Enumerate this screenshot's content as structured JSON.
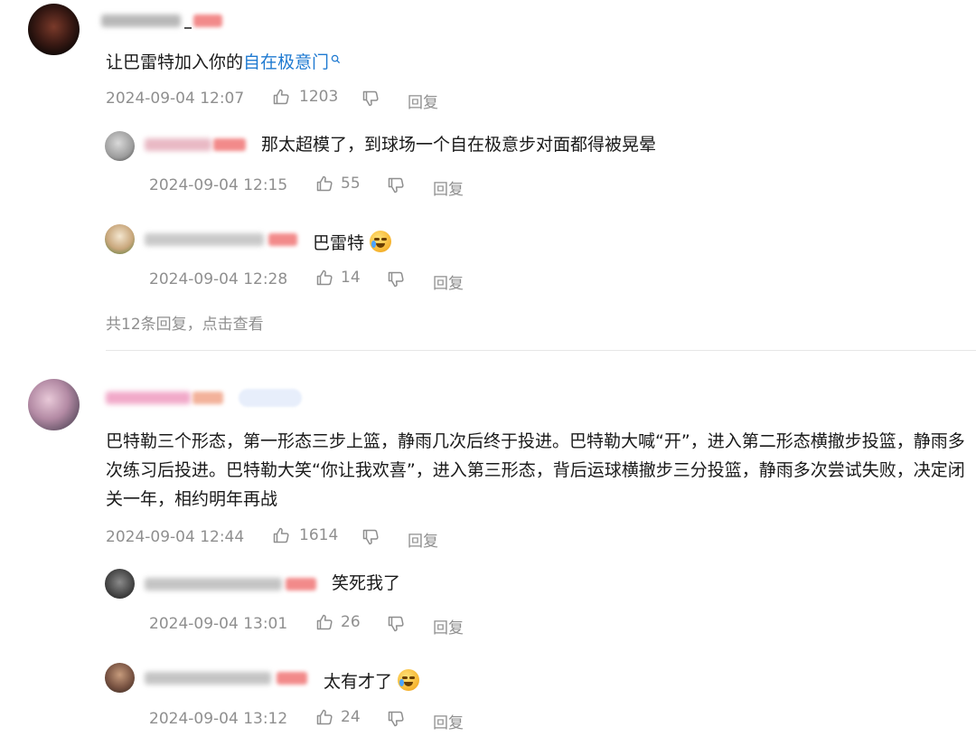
{
  "comment1": {
    "text_before": "让巴雷特加入你的",
    "link_text": "自在极意门",
    "time": "2024-09-04 12:07",
    "likes": "1203",
    "reply_label": "回复"
  },
  "reply1a": {
    "text": "那太超模了，到球场一个自在极意步对面都得被晃晕",
    "time": "2024-09-04 12:15",
    "likes": "55",
    "reply_label": "回复"
  },
  "reply1b": {
    "text": "巴雷特",
    "time": "2024-09-04 12:28",
    "likes": "14",
    "reply_label": "回复"
  },
  "more_replies": "共12条回复，点击查看",
  "comment2": {
    "text": "巴特勒三个形态，第一形态三步上篮，静雨几次后终于投进。巴特勒大喊“开”，进入第二形态横撤步投篮，静雨多次练习后投进。巴特勒大笑“你让我欢喜”，进入第三形态，背后运球横撤步三分投篮，静雨多次尝试失败，决定闭关一年，相约明年再战",
    "time": "2024-09-04 12:44",
    "likes": "1614",
    "reply_label": "回复"
  },
  "reply2a": {
    "text": "笑死我了",
    "time": "2024-09-04 13:01",
    "likes": "26",
    "reply_label": "回复"
  },
  "reply2b": {
    "text": "太有才了",
    "time": "2024-09-04 13:12",
    "likes": "24",
    "reply_label": "回复"
  },
  "colors": {
    "link": "#1f7ad1",
    "meta": "#8f8f8f",
    "badge": "#f28a8a"
  }
}
